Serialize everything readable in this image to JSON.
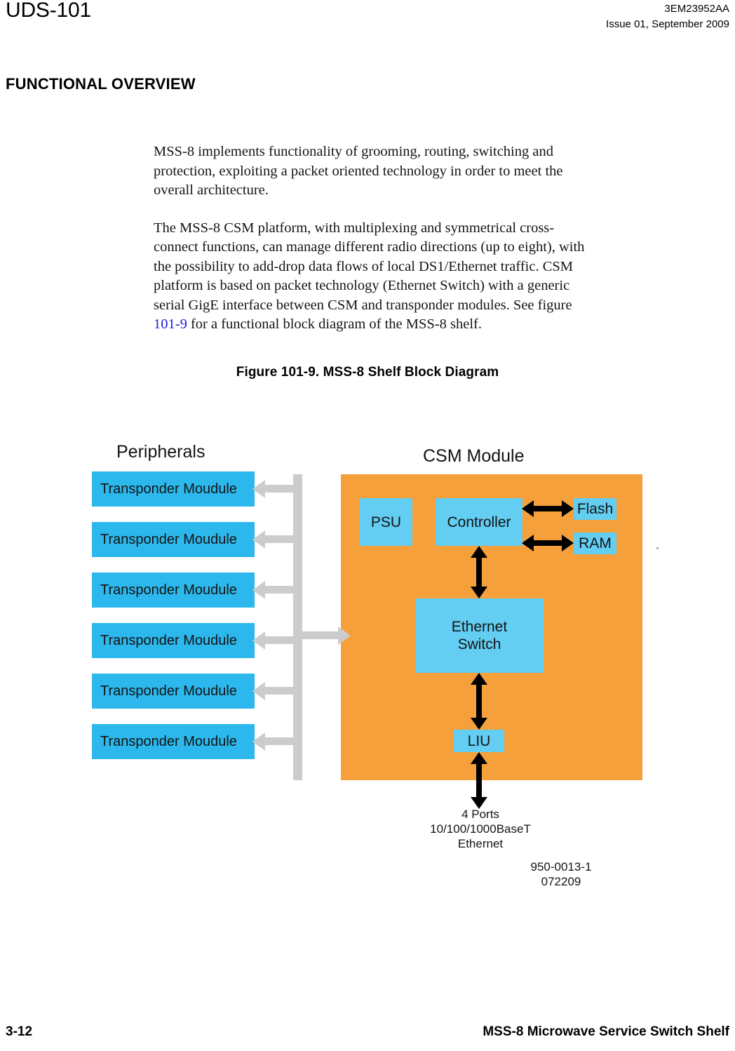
{
  "header": {
    "doc_code": "UDS-101",
    "part_number": "3EM23952AA",
    "issue": "Issue 01, September 2009"
  },
  "section": {
    "title": "FUNCTIONAL OVERVIEW"
  },
  "body": {
    "paragraph_1": "MSS-8 implements functionality of grooming, routing, switching and protection, exploiting a packet oriented technology in order to meet the overall architecture.",
    "paragraph_2_part_1": "The MSS-8 CSM platform, with multiplexing and symmetrical cross-connect functions, can manage different radio directions (up to eight), with the possibility to add-drop data flows of local DS1/Ethernet traffic. CSM platform is based on packet technology (Ethernet Switch) with a generic serial GigE interface between CSM and transponder modules. See figure ",
    "paragraph_2_link": "101-9",
    "paragraph_2_part_2": " for a functional block diagram of the MSS-8 shelf."
  },
  "figure": {
    "caption": "Figure 101-9. MSS-8 Shelf Block Diagram",
    "labels": {
      "peripherals": "Peripherals",
      "csm_module": "CSM Module"
    },
    "transponders": [
      {
        "label": "Transponder Moudule"
      },
      {
        "label": "Transponder Moudule"
      },
      {
        "label": "Transponder Moudule"
      },
      {
        "label": "Transponder Moudule"
      },
      {
        "label": "Transponder Moudule"
      },
      {
        "label": "Transponder Moudule"
      }
    ],
    "blocks": {
      "psu": "PSU",
      "controller": "Controller",
      "flash": "Flash",
      "ram": "RAM",
      "ethernet_switch_line1": "Ethernet",
      "ethernet_switch_line2": "Switch",
      "liu": "LIU"
    },
    "port_label": {
      "line1": "4 Ports",
      "line2": "10/100/1000BaseT",
      "line3": "Ethernet"
    },
    "drawing_id": {
      "number": "950-0013-1",
      "date_code": "072209"
    },
    "colors": {
      "csm_panel": "#f5a03a",
      "transponder_block": "#2cb8ec",
      "inner_block": "#63cdf2",
      "bus": "#cccccc",
      "arrow": "#000000",
      "link": "#1a18e8"
    }
  },
  "footer": {
    "page_number": "3-12",
    "document_title": "MSS-8 Microwave Service Switch Shelf"
  }
}
